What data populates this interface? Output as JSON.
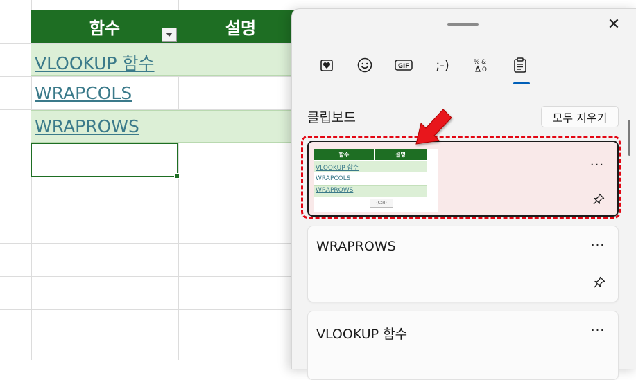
{
  "sheet": {
    "header": {
      "col1": "함수",
      "col2": "설명"
    },
    "rows": [
      "VLOOKUP 함수",
      "WRAPCOLS",
      "WRAPROWS"
    ]
  },
  "clipboard": {
    "tabs": [
      "favorites-emoji-icon",
      "emoji-icon",
      "gif-icon",
      "kaomoji-icon",
      "symbols-icon",
      "clipboard-icon"
    ],
    "tab_labels": {
      "gif": "GIF",
      "kaomoji": ";-)"
    },
    "active_tab": "clipboard",
    "section_title": "클립보드",
    "clear_all_label": "모두 지우기",
    "items": [
      {
        "type": "image",
        "thumb": {
          "header": [
            "함수",
            "설명"
          ],
          "rows": [
            "VLOOKUP 함수",
            "WRAPCOLS",
            "WRAPROWS"
          ],
          "paste_label": "(Ctrl)"
        }
      },
      {
        "type": "text",
        "text": "WRAPROWS"
      },
      {
        "type": "text",
        "text": "VLOOKUP 함수"
      }
    ],
    "more_glyph": "···"
  },
  "colors": {
    "excel_green": "#1e6e23",
    "band_green": "#dcefd6",
    "link": "#3b7a8a",
    "accent_blue": "#005fb8",
    "annotation_red": "#e30613"
  }
}
